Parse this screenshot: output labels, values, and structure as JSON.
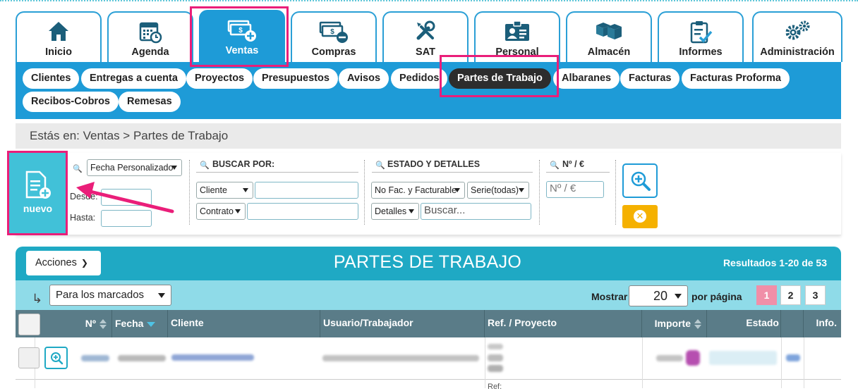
{
  "colors": {
    "primary": "#1e9bd7",
    "teal": "#1fa9c4",
    "nuevo": "#41c1d8",
    "highlight": "#ea1e79",
    "clear": "#f5b100",
    "page_active": "#f08fa8"
  },
  "main_tabs": [
    {
      "label": "Inicio",
      "icon": "home-icon"
    },
    {
      "label": "Agenda",
      "icon": "calendar-clock-icon"
    },
    {
      "label": "Ventas",
      "icon": "money-plus-icon",
      "active": true
    },
    {
      "label": "Compras",
      "icon": "money-minus-icon"
    },
    {
      "label": "SAT",
      "icon": "tools-icon"
    },
    {
      "label": "Personal",
      "icon": "id-card-icon"
    },
    {
      "label": "Almacén",
      "icon": "boxes-icon"
    },
    {
      "label": "Informes",
      "icon": "clipboard-check-icon"
    },
    {
      "label": "Administración",
      "icon": "gears-icon"
    }
  ],
  "sub_nav": [
    {
      "label": "Clientes"
    },
    {
      "label": "Entregas a cuenta"
    },
    {
      "label": "Proyectos"
    },
    {
      "label": "Presupuestos"
    },
    {
      "label": "Avisos"
    },
    {
      "label": "Pedidos"
    },
    {
      "label": "Partes de Trabajo",
      "active": true
    },
    {
      "label": "Albaranes"
    },
    {
      "label": "Facturas"
    },
    {
      "label": "Facturas Proforma"
    },
    {
      "label": "Recibos-Cobros"
    },
    {
      "label": "Remesas"
    }
  ],
  "breadcrumb": "Estás en: Ventas > Partes de Trabajo",
  "nuevo_label": "nuevo",
  "filters": {
    "date_select": "Fecha Personalizado",
    "desde_label": "Desde:",
    "hasta_label": "Hasta:",
    "buscar_por_heading": "BUSCAR POR:",
    "buscar_select_1": "Cliente",
    "buscar_select_2": "Contrato",
    "estado_heading": "ESTADO Y DETALLES",
    "estado_select": "No Fac. y Facturable",
    "serie_select": "Serie(todas)",
    "detalles_select": "Detalles",
    "detalles_placeholder": "Buscar...",
    "num_heading": "Nº / €",
    "num_placeholder": "Nº / €"
  },
  "results": {
    "acciones_label": "Acciones",
    "title": "PARTES DE TRABAJO",
    "count_text": "Resultados 1-20 de 53",
    "bulk_select": "Para los marcados",
    "mostrar_label": "Mostrar",
    "per_page": "20",
    "por_pagina_label": "por página",
    "pages": [
      "1",
      "2",
      "3"
    ],
    "current_page": "1",
    "columns": [
      "Nº",
      "Fecha",
      "Cliente",
      "Usuario/Trabajador",
      "Ref. / Proyecto",
      "Importe",
      "Estado",
      "Info."
    ],
    "second_row_ref_partial": "Ref:"
  }
}
